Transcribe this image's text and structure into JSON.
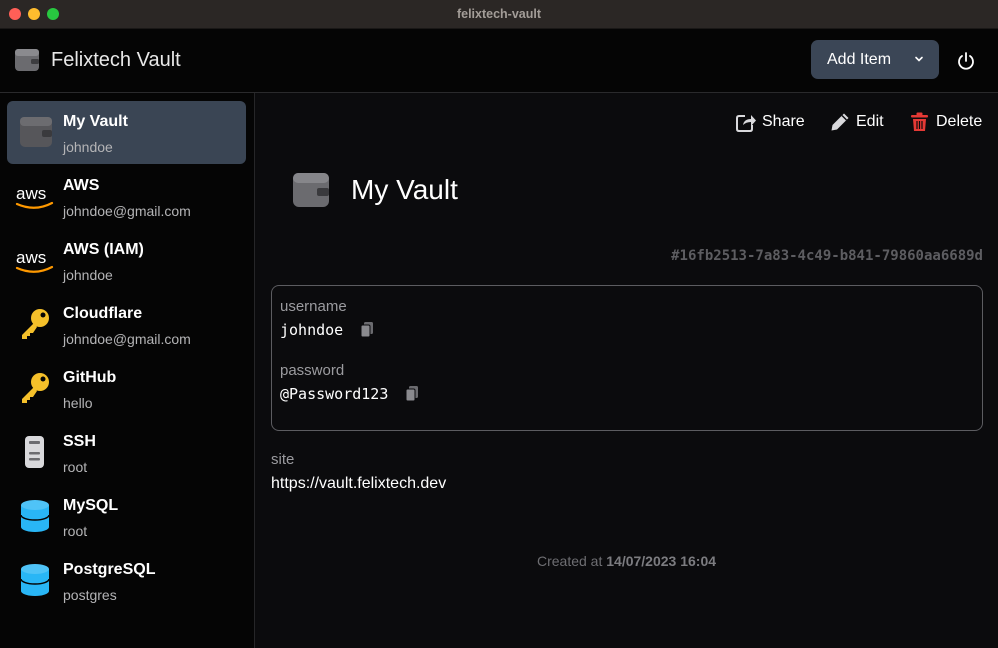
{
  "window": {
    "title": "felixtech-vault"
  },
  "header": {
    "app_name": "Felixtech Vault",
    "add_item_label": "Add Item",
    "add_item_icon": "chevron-down-icon",
    "power_icon": "power-icon"
  },
  "sidebar": {
    "selected_index": 0,
    "items": [
      {
        "title": "My Vault",
        "subtitle": "johndoe",
        "icon": "wallet-icon"
      },
      {
        "title": "AWS",
        "subtitle": "johndoe@gmail.com",
        "icon": "aws-logo-icon"
      },
      {
        "title": "AWS (IAM)",
        "subtitle": "johndoe",
        "icon": "aws-logo-icon"
      },
      {
        "title": "Cloudflare",
        "subtitle": "johndoe@gmail.com",
        "icon": "key-icon"
      },
      {
        "title": "GitHub",
        "subtitle": "hello",
        "icon": "key-icon"
      },
      {
        "title": "SSH",
        "subtitle": "root",
        "icon": "server-icon"
      },
      {
        "title": "MySQL",
        "subtitle": "root",
        "icon": "database-icon"
      },
      {
        "title": "PostgreSQL",
        "subtitle": "postgres",
        "icon": "database-icon"
      }
    ]
  },
  "aws_logo_text": "aws",
  "detail": {
    "actions": {
      "share_label": "Share",
      "edit_label": "Edit",
      "delete_label": "Delete",
      "delete_color": "#e53935"
    },
    "title": "My Vault",
    "id": "#16fb2513-7a83-4c49-b841-79860aa6689d",
    "fields": {
      "username_label": "username",
      "username_value": "johndoe",
      "password_label": "password",
      "password_value": "@Password123"
    },
    "site_label": "site",
    "site_value": "https://vault.felixtech.dev",
    "created_prefix": "Created at",
    "created_value": "14/07/2023 16:04"
  },
  "colors": {
    "accent_button": "#3b4656",
    "selected_item": "#3a4554",
    "key_yellow": "#f5c02a",
    "database_blue": "#29b6f6"
  }
}
